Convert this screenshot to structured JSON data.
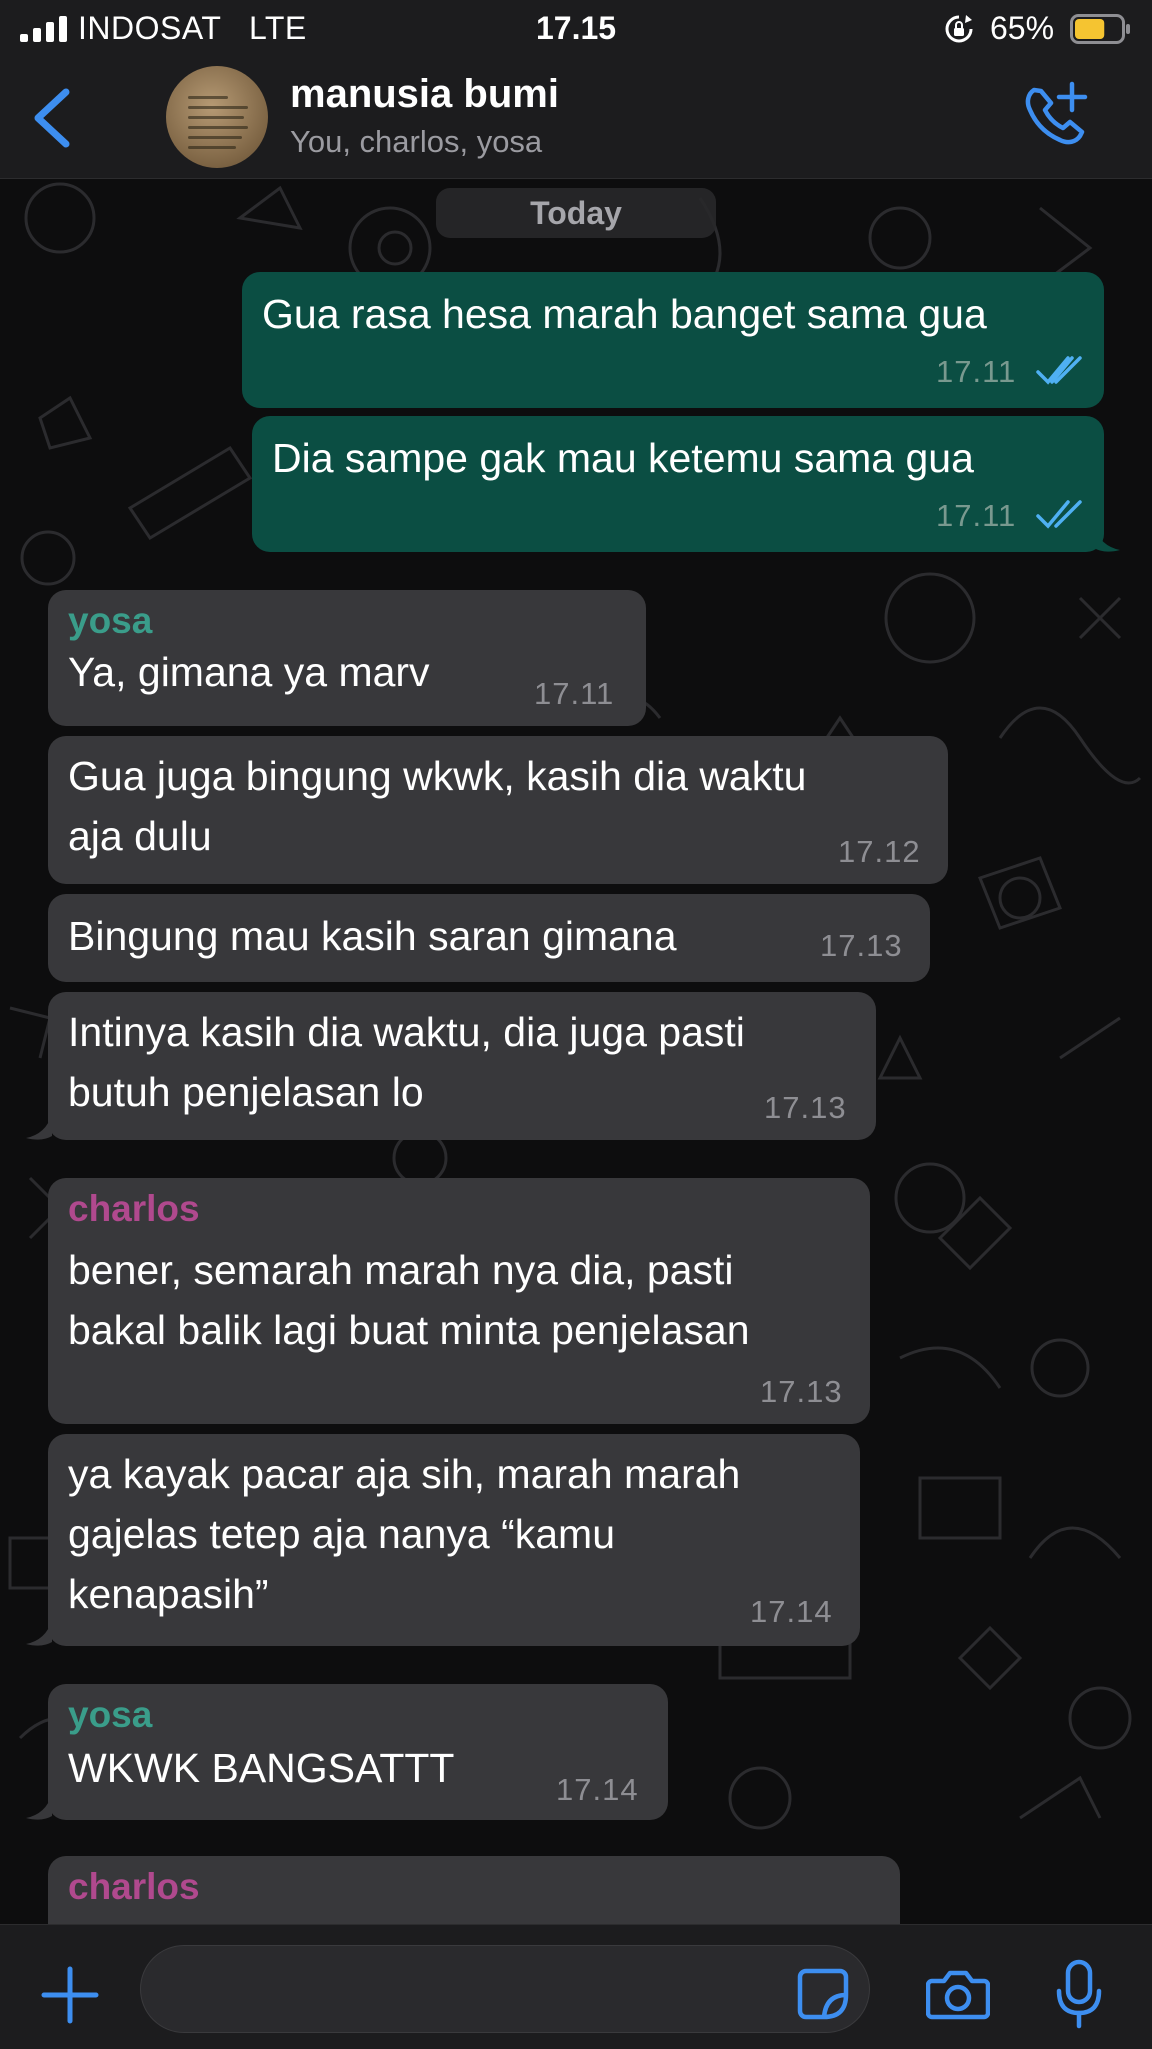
{
  "status_bar": {
    "carrier": "INDOSAT   LTE",
    "time": "17.15",
    "battery_percent": "65%",
    "battery_level": 0.65
  },
  "header": {
    "title": "manusia bumi",
    "subtitle": "You, charlos, yosa",
    "back_icon": "chevron-left-icon",
    "call_icon": "add-call-icon"
  },
  "date_label": "Today",
  "messages": [
    {
      "direction": "outgoing",
      "text": "Gua rasa hesa marah banget sama gua",
      "time": "17.11",
      "status": "read"
    },
    {
      "direction": "outgoing",
      "text": "Dia sampe gak mau ketemu sama gua",
      "time": "17.11",
      "status": "read"
    },
    {
      "direction": "incoming",
      "sender": "yosa",
      "lines": [
        "Ya, gimana ya marv"
      ],
      "time": "17.11"
    },
    {
      "direction": "incoming",
      "lines": [
        "Gua juga bingung wkwk, kasih dia waktu",
        "aja dulu"
      ],
      "time": "17.12"
    },
    {
      "direction": "incoming",
      "lines": [
        "Bingung mau kasih saran gimana"
      ],
      "time": "17.13"
    },
    {
      "direction": "incoming",
      "lines": [
        "Intinya kasih dia waktu, dia juga pasti",
        "butuh penjelasan lo"
      ],
      "time": "17.13"
    },
    {
      "direction": "incoming",
      "sender": "charlos",
      "lines": [
        "bener, semarah marah nya dia, pasti",
        "bakal balik lagi buat minta penjelasan"
      ],
      "time": "17.13"
    },
    {
      "direction": "incoming",
      "lines": [
        "ya kayak pacar aja sih, marah marah",
        "gajelas tetep aja nanya “kamu",
        "kenapasih”"
      ],
      "time": "17.14"
    },
    {
      "direction": "incoming",
      "sender": "yosa",
      "lines": [
        "WKWK BANGSATTT"
      ],
      "time": "17.14"
    },
    {
      "direction": "incoming",
      "sender": "charlos",
      "lines": [],
      "time": ""
    }
  ],
  "colors": {
    "outgoing_bubble": "#0b4e43",
    "incoming_bubble": "#38383b",
    "accent": "#3d8ef0",
    "sender_yosa": "#3a9d8a",
    "sender_charlos": "#b0498e",
    "read_ticks": "#4fb0f2"
  },
  "input_bar": {
    "plus_icon": "plus-icon",
    "sticker_icon": "sticker-icon",
    "camera_icon": "camera-icon",
    "mic_icon": "microphone-icon"
  }
}
